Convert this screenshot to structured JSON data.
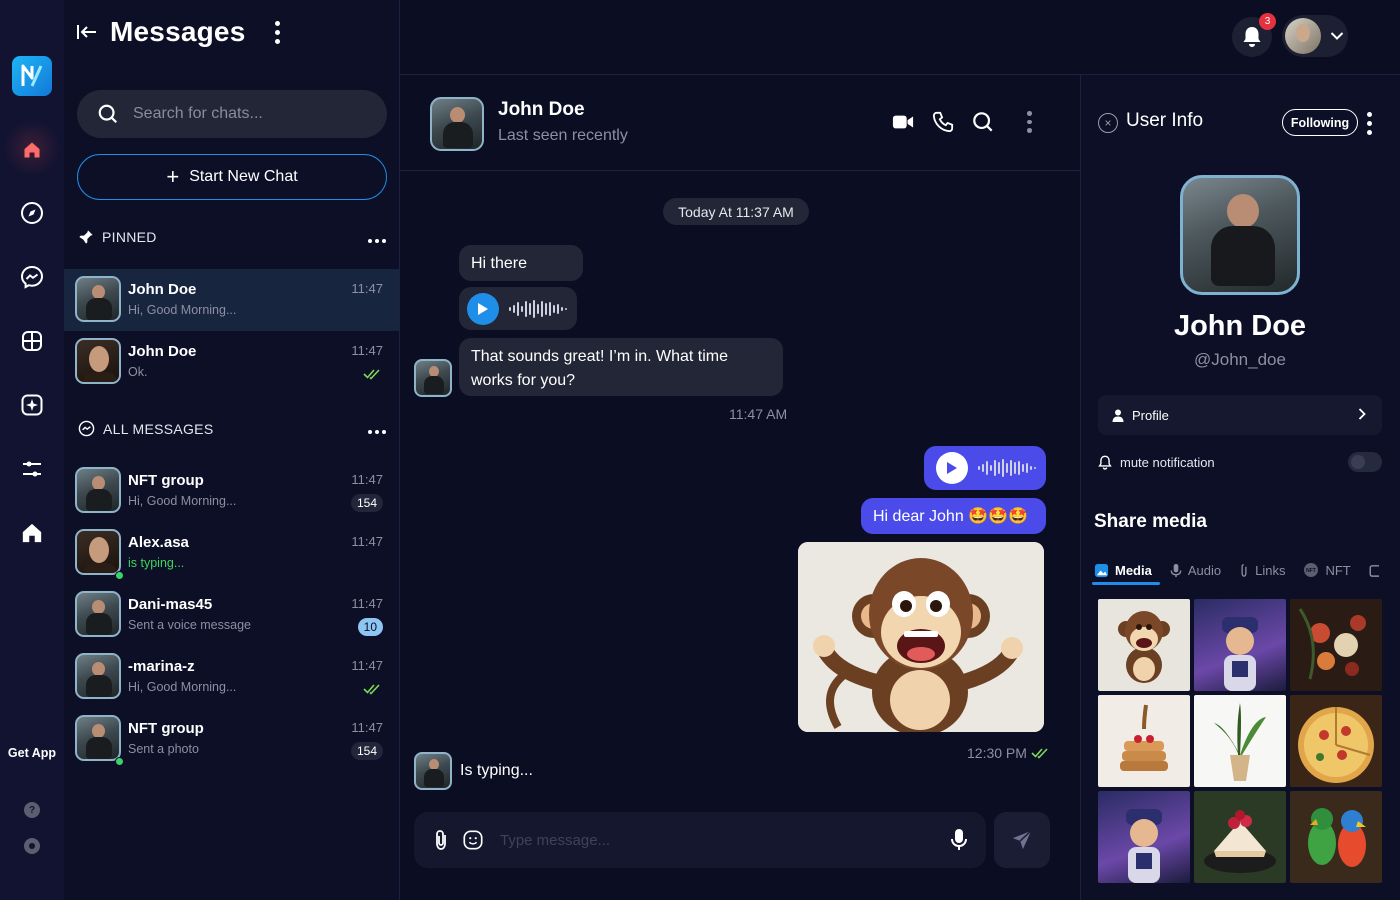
{
  "header": {
    "title": "Messages",
    "notification_count": "3"
  },
  "sidebar": {
    "get_app_label": "Get App",
    "help_glyph": "?",
    "items": [
      {
        "name": "home",
        "icon": "home-outline-icon",
        "active": true
      },
      {
        "name": "explore",
        "icon": "compass-icon"
      },
      {
        "name": "messenger",
        "icon": "messenger-icon"
      },
      {
        "name": "apps",
        "icon": "grid-icon"
      },
      {
        "name": "ai",
        "icon": "sparkle-icon"
      },
      {
        "name": "filters",
        "icon": "sliders-icon"
      },
      {
        "name": "house",
        "icon": "house-icon"
      }
    ]
  },
  "chat_list": {
    "search_placeholder": "Search for chats...",
    "new_chat_label": "Start New Chat",
    "pinned_label": "PINNED",
    "all_messages_label": "ALL MESSAGES",
    "pinned": [
      {
        "name": "John Doe",
        "preview": "Hi, Good Morning...",
        "time": "11:47",
        "active": true
      },
      {
        "name": "John Doe",
        "preview": "Ok.",
        "time": "11:47",
        "status": "read"
      }
    ],
    "all": [
      {
        "name": "NFT group",
        "preview": "Hi, Good Morning...",
        "time": "11:47",
        "badge": "154"
      },
      {
        "name": "Alex.asa",
        "preview": "is typing...",
        "time": "11:47",
        "online": true
      },
      {
        "name": "Dani-mas45",
        "preview": "Sent a voice message",
        "time": "11:47",
        "badge": "10"
      },
      {
        "name": "-marina-z",
        "preview": "Hi, Good Morning...",
        "time": "11:47",
        "status": "read"
      },
      {
        "name": "NFT group",
        "preview": "Sent a photo",
        "time": "11:47",
        "badge": "154",
        "online": true
      }
    ]
  },
  "conversation": {
    "name": "John Doe",
    "status": "Last seen recently",
    "date_label": "Today At 11:37 AM",
    "messages": {
      "in_1": "Hi there",
      "in_3": "That sounds great! I’m in. What time works for you?",
      "in_time": "11:47 AM",
      "out_2": "Hi dear John 🤩🤩🤩",
      "out_time": "12:30 PM"
    },
    "typing_text": "Is typing...",
    "composer_placeholder": "Type message..."
  },
  "user_info": {
    "title": "User Info",
    "following_label": "Following",
    "name": "John Doe",
    "handle": "@John_doe",
    "profile_label": "Profile",
    "mute_label": "mute notification",
    "mute_on": false,
    "share_title": "Share media",
    "tabs": [
      "Media",
      "Audio",
      "Links",
      "NFT"
    ],
    "active_tab": "Media"
  },
  "colors": {
    "accent_blue": "#1e8ee8",
    "outgoing_bubble": "#4a4be9",
    "incoming_bubble": "#232636",
    "online_green": "#38d46a",
    "badge_red": "#e5323f"
  }
}
